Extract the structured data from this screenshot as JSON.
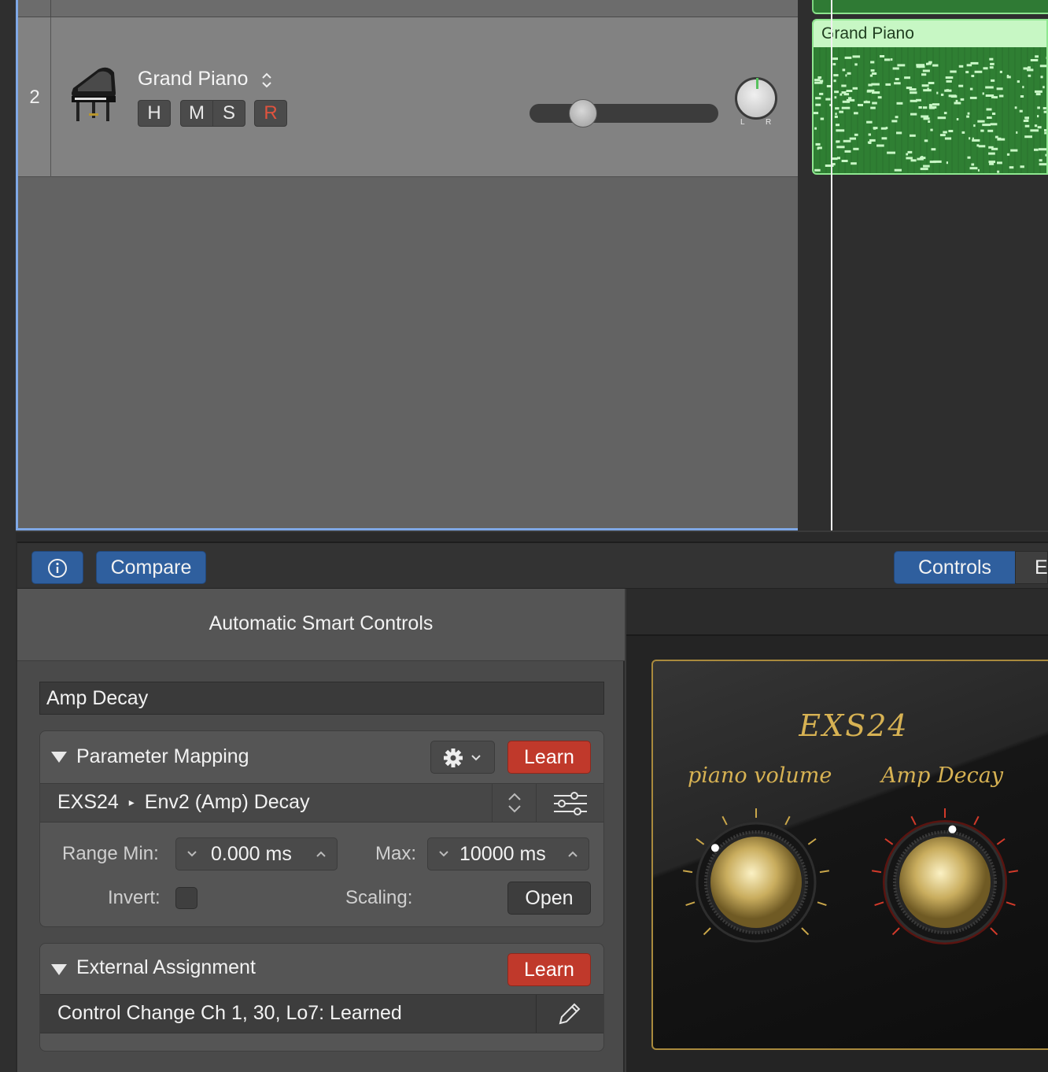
{
  "track": {
    "number": "2",
    "name": "Grand Piano",
    "buttons": {
      "hide": "H",
      "mute": "M",
      "solo": "S",
      "record": "R"
    },
    "pan_labels": {
      "left": "L",
      "right": "R"
    }
  },
  "region": {
    "title": "Grand Piano",
    "color": "#2f7f33"
  },
  "toolbar": {
    "compare_label": "Compare",
    "controls_tab": "Controls",
    "next_tab": "E"
  },
  "inspector": {
    "title": "Automatic Smart Controls",
    "control_name": "Amp Decay",
    "parameter_mapping": {
      "title": "Parameter Mapping",
      "learn_label": "Learn",
      "param_plugin": "EXS24",
      "param_name": "Env2 (Amp) Decay",
      "range_min_label": "Range Min:",
      "range_min_value": "0.000 ms",
      "max_label": "Max:",
      "max_value": "10000 ms",
      "invert_label": "Invert:",
      "invert_checked": false,
      "scaling_label": "Scaling:",
      "open_label": "Open"
    },
    "external_assignment": {
      "title": "External Assignment",
      "learn_label": "Learn",
      "assignment": "Control Change Ch 1, 30, Lo7: Learned"
    }
  },
  "smart_controls": {
    "title": "EXS24",
    "knobs": [
      {
        "label": "piano volume",
        "selected": false
      },
      {
        "label": "Amp Decay",
        "selected": true
      }
    ]
  },
  "colors": {
    "accent_blue": "#2f5f9e",
    "learn_red": "#c0392b",
    "gold": "#d7b253",
    "region_green": "#2f7f33"
  }
}
